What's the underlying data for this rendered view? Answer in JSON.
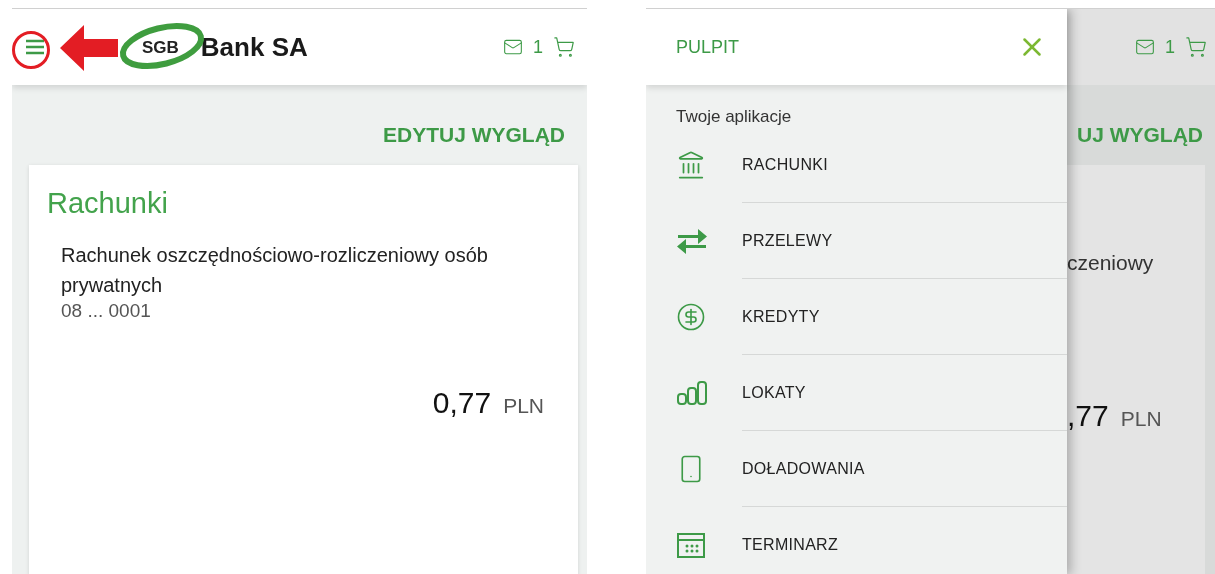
{
  "left_screen": {
    "header": {
      "logo_mark": "SGB",
      "brand": "Bank SA",
      "message_count": "1"
    },
    "edit_link": "EDYTUJ WYGLĄD",
    "card": {
      "title": "Rachunki",
      "account_name": "Rachunek oszczędnościowo-rozliczeniowy osób prywatnych",
      "account_number": "08 ... 0001",
      "amount": "0,77",
      "currency": "PLN"
    }
  },
  "right_screen": {
    "drawer": {
      "title": "PULPIT",
      "section": "Twoje aplikacje",
      "items": [
        {
          "kind": "bank",
          "label": "RACHUNKI"
        },
        {
          "kind": "transfer",
          "label": "PRZELEWY"
        },
        {
          "kind": "credit",
          "label": "KREDYTY"
        },
        {
          "kind": "deposit",
          "label": "LOKATY"
        },
        {
          "kind": "phone",
          "label": "DOŁADOWANIA"
        },
        {
          "kind": "calendar",
          "label": "TERMINARZ"
        }
      ]
    },
    "background": {
      "message_count": "1",
      "edit_link": "UJ WYGLĄD",
      "account_fragment": "czeniowy",
      "amount": ",77",
      "currency": "PLN"
    }
  }
}
